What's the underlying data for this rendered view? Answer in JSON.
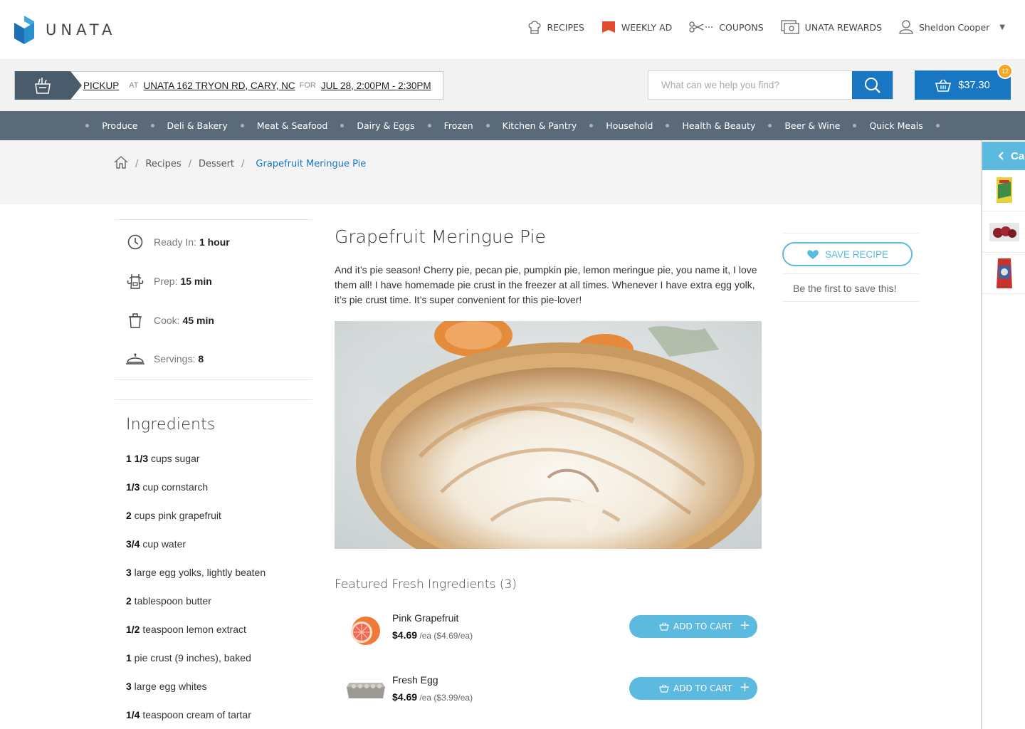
{
  "brand": {
    "name": "UNATA"
  },
  "topnav": {
    "recipes": "RECIPES",
    "weekly_ad": "WEEKLY AD",
    "coupons": "COUPONS",
    "rewards": "UNATA REWARDS",
    "user": "Sheldon Cooper"
  },
  "pickup": {
    "mode": "PICKUP",
    "at_label": "AT",
    "location": "UNATA 162 TRYON RD, CARY, NC",
    "for_label": "FOR",
    "time": "JUL 28, 2:00PM - 2:30PM"
  },
  "search": {
    "placeholder": "What can we help you find?"
  },
  "cart": {
    "total": "$37.30",
    "count": "12"
  },
  "categories": [
    "Produce",
    "Deli & Bakery",
    "Meat & Seafood",
    "Dairy & Eggs",
    "Frozen",
    "Kitchen & Pantry",
    "Household",
    "Health & Beauty",
    "Beer & Wine",
    "Quick Meals"
  ],
  "breadcrumb": {
    "sep": "/",
    "recipes": "Recipes",
    "category": "Dessert",
    "current": "Grapefruit Meringue Pie"
  },
  "meta": {
    "ready_label": "Ready In:",
    "ready_value": "1 hour",
    "prep_label": "Prep:",
    "prep_value": "15 min",
    "cook_label": "Cook:",
    "cook_value": "45 min",
    "servings_label": "Servings:",
    "servings_value": "8"
  },
  "ingredients_title": "Ingredients",
  "ingredients": [
    {
      "qty": "1 1/3",
      "text": " cups sugar"
    },
    {
      "qty": "1/3",
      "text": " cup cornstarch"
    },
    {
      "qty": "2",
      "text": " cups pink grapefruit"
    },
    {
      "qty": "3/4",
      "text": " cup water"
    },
    {
      "qty": "3",
      "text": " large egg yolks, lightly beaten"
    },
    {
      "qty": "2",
      "text": " tablespoon butter"
    },
    {
      "qty": "1/2",
      "text": " teaspoon lemon extract"
    },
    {
      "qty": "1",
      "text": " pie crust (9 inches), baked"
    },
    {
      "qty": "3",
      "text": " large egg whites"
    },
    {
      "qty": "1/4",
      "text": " teaspoon cream of tartar"
    }
  ],
  "recipe": {
    "title": "Grapefruit Meringue Pie",
    "description": "And it’s pie season! Cherry pie, pecan pie, pumpkin pie, lemon meringue pie, you name it, I love them all! I have homemade pie crust in the freezer at all times. Whenever I have extra egg yolk, it’s pie crust time. It’s super convenient for this pie-lover!"
  },
  "save": {
    "label": "SAVE RECIPE",
    "note": "Be the first to save this!"
  },
  "featured": {
    "title": "Featured Fresh Ingredients (3)",
    "add_label": "ADD TO CART",
    "products": [
      {
        "name": "Pink Grapefruit",
        "price": "$4.69",
        "unit": " /ea ($4.69/ea)"
      },
      {
        "name": "Fresh Egg",
        "price": "$4.69",
        "unit": " /ea ($3.99/ea)"
      }
    ]
  },
  "drawer": {
    "label": "Ca"
  },
  "colors": {
    "primary": "#1976c2",
    "accent": "#5cb9e0",
    "nav": "#5a6a78",
    "badge": "#f5a623"
  }
}
